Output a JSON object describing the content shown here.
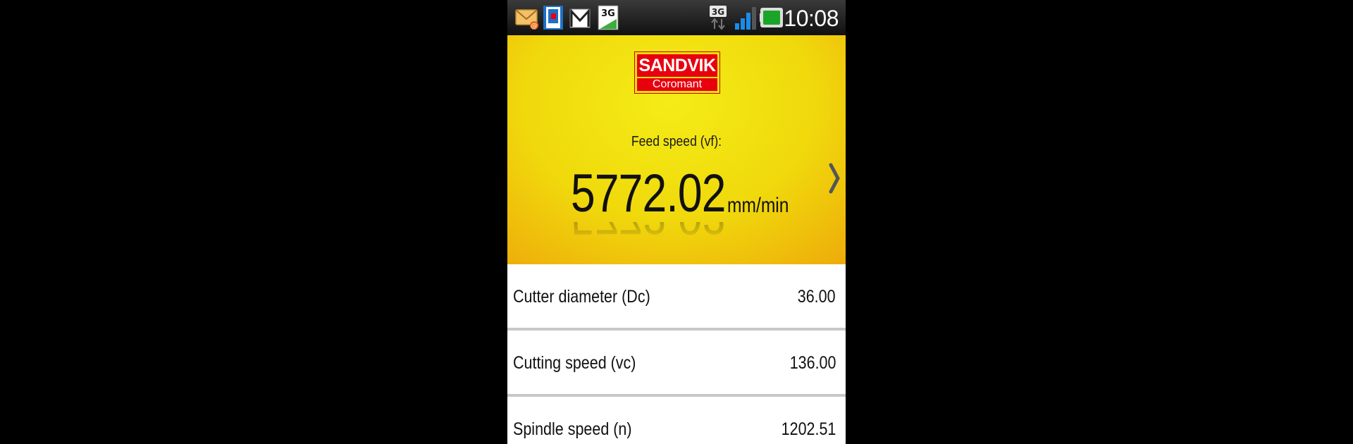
{
  "status_bar": {
    "time": "10:08",
    "network_badge": "3G",
    "notification_badge": "3G",
    "icons": [
      "mail-icon",
      "app-icon",
      "gmail-icon",
      "3g-notification-icon",
      "3g-data-icon",
      "signal-icon",
      "battery-icon"
    ]
  },
  "brand": {
    "name_top": "SANDVIK",
    "name_bottom": "Coromant",
    "colors": {
      "red": "#e8000f",
      "yellow": "#f4e10c"
    }
  },
  "result": {
    "label": "Feed speed (vf):",
    "value": "5772.02",
    "unit": "mm/min"
  },
  "parameters": [
    {
      "label": "Cutter diameter (Dc)",
      "value": "36.00"
    },
    {
      "label": "Cutting speed (vc)",
      "value": "136.00"
    },
    {
      "label": "Spindle speed (n)",
      "value": "1202.51"
    }
  ]
}
